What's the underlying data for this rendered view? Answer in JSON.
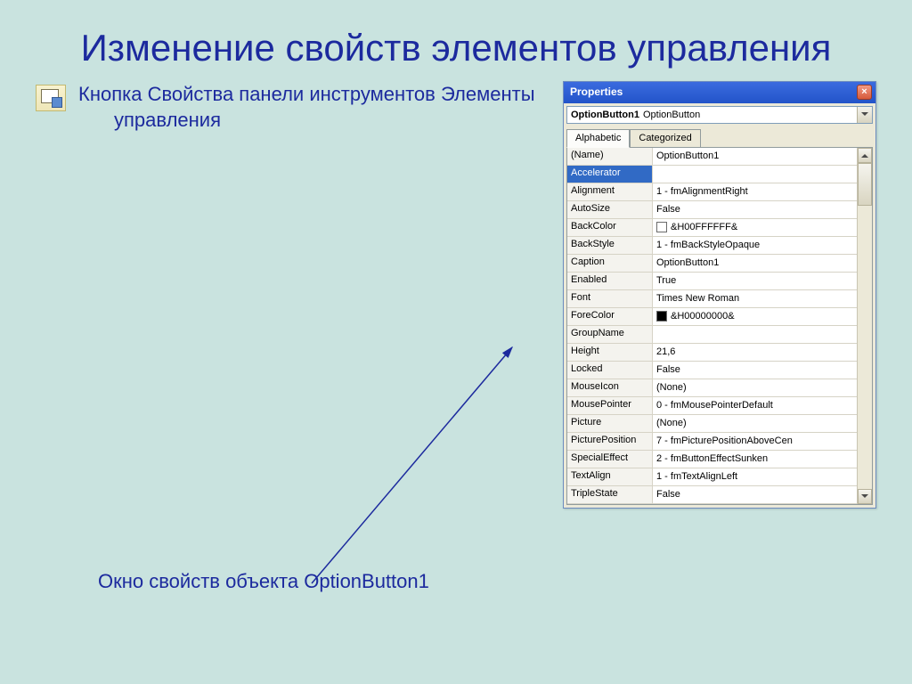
{
  "slide": {
    "title": "Изменение свойств элементов управления",
    "description": "Кнопка Свойства панели инструментов Элементы управления",
    "caption": "Окно свойств объекта OptionButton1"
  },
  "propwin": {
    "title": "Properties",
    "object_name": "OptionButton1",
    "object_type": "OptionButton",
    "tabs": {
      "alphabetic": "Alphabetic",
      "categorized": "Categorized"
    },
    "rows": [
      {
        "name": "(Name)",
        "value": "OptionButton1"
      },
      {
        "name": "Accelerator",
        "value": "",
        "selected": true
      },
      {
        "name": "Alignment",
        "value": "1 - fmAlignmentRight"
      },
      {
        "name": "AutoSize",
        "value": "False"
      },
      {
        "name": "BackColor",
        "value": "&H00FFFFFF&",
        "swatch": "#ffffff"
      },
      {
        "name": "BackStyle",
        "value": "1 - fmBackStyleOpaque"
      },
      {
        "name": "Caption",
        "value": "OptionButton1"
      },
      {
        "name": "Enabled",
        "value": "True"
      },
      {
        "name": "Font",
        "value": "Times New Roman"
      },
      {
        "name": "ForeColor",
        "value": "&H00000000&",
        "swatch": "#000000"
      },
      {
        "name": "GroupName",
        "value": ""
      },
      {
        "name": "Height",
        "value": "21,6"
      },
      {
        "name": "Locked",
        "value": "False"
      },
      {
        "name": "MouseIcon",
        "value": "(None)"
      },
      {
        "name": "MousePointer",
        "value": "0 - fmMousePointerDefault"
      },
      {
        "name": "Picture",
        "value": "(None)"
      },
      {
        "name": "PicturePosition",
        "value": "7 - fmPicturePositionAboveCen"
      },
      {
        "name": "SpecialEffect",
        "value": "2 - fmButtonEffectSunken"
      },
      {
        "name": "TextAlign",
        "value": "1 - fmTextAlignLeft"
      },
      {
        "name": "TripleState",
        "value": "False"
      }
    ]
  }
}
